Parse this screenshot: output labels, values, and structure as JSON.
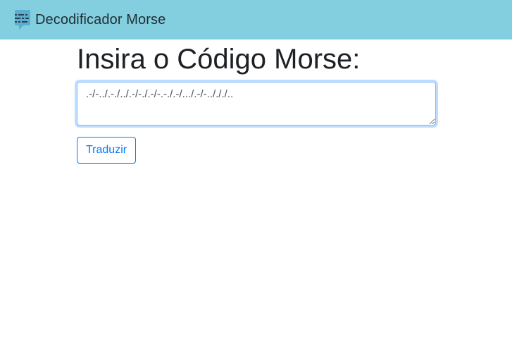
{
  "navbar": {
    "brand_text": "Decodificador Morse",
    "logo_icon": "morse-chat-icon",
    "background_color": "#83cfe0"
  },
  "main": {
    "heading": "Insira o Código Morse:",
    "morse_input": {
      "value": ".-/-../.-./../.-/-./.-/-.-./.-/.../.-/-../././.."
    },
    "translate_button_label": "Traduzir",
    "accent_color": "#007bff"
  }
}
